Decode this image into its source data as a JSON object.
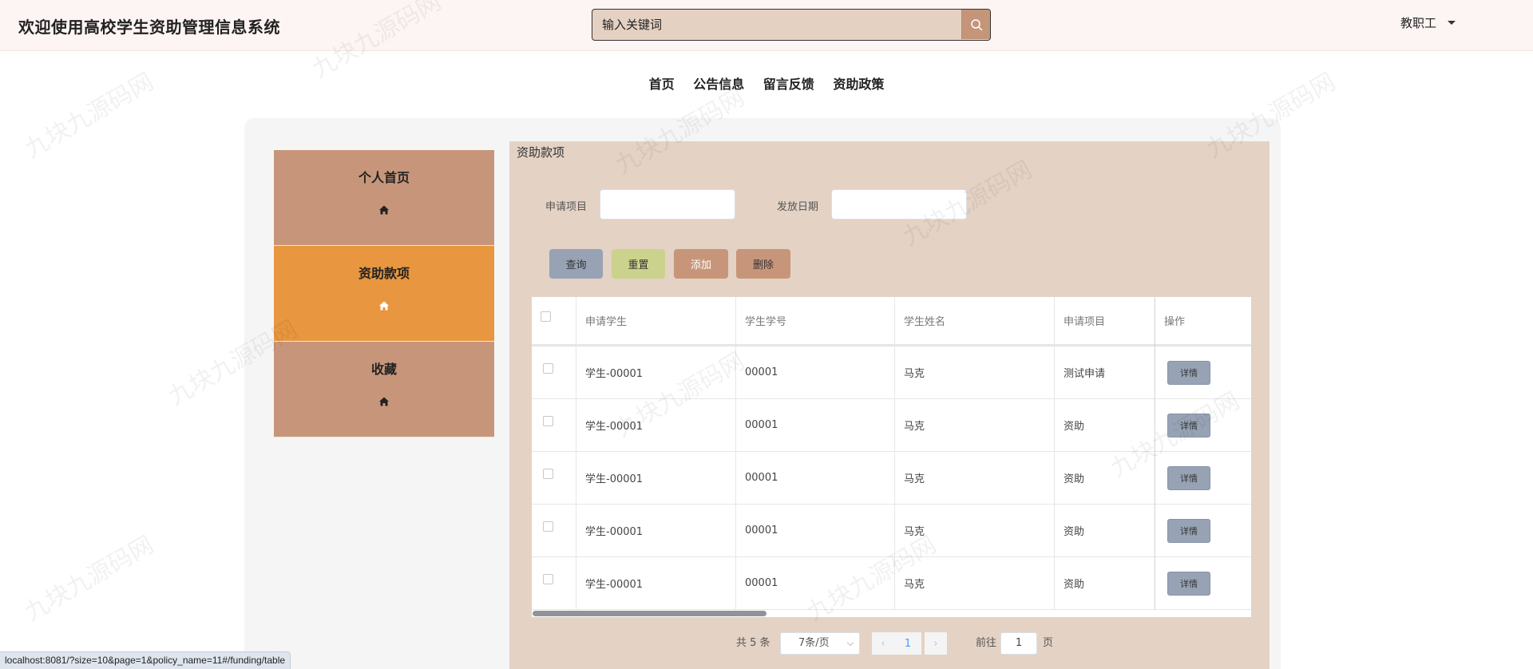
{
  "header": {
    "title": "欢迎使用高校学生资助管理信息系统",
    "search_placeholder": "输入关键词",
    "search_icon": "search-icon",
    "user_label": "教职工"
  },
  "nav": {
    "items": [
      {
        "label": "首页"
      },
      {
        "label": "公告信息"
      },
      {
        "label": "留言反馈"
      },
      {
        "label": "资助政策"
      }
    ]
  },
  "sidebar": {
    "items": [
      {
        "label": "个人首页",
        "icon": "home-icon",
        "active": false
      },
      {
        "label": "资助款项",
        "icon": "home-icon",
        "active": true
      },
      {
        "label": "收藏",
        "icon": "home-icon",
        "active": false
      }
    ]
  },
  "content": {
    "title": "资助款项",
    "filters": {
      "project_label": "申请项目",
      "date_label": "发放日期"
    },
    "buttons": {
      "query": "查询",
      "reset": "重置",
      "add": "添加",
      "delete": "删除"
    },
    "table": {
      "columns": [
        "申请学生",
        "学生学号",
        "学生姓名",
        "申请项目",
        "操作"
      ],
      "rows": [
        {
          "student": "学生-00001",
          "number": "00001",
          "name": "马克",
          "project": "测试申请",
          "action": "详情"
        },
        {
          "student": "学生-00001",
          "number": "00001",
          "name": "马克",
          "project": "资助",
          "action": "详情"
        },
        {
          "student": "学生-00001",
          "number": "00001",
          "name": "马克",
          "project": "资助",
          "action": "详情"
        },
        {
          "student": "学生-00001",
          "number": "00001",
          "name": "马克",
          "project": "资助",
          "action": "详情"
        },
        {
          "student": "学生-00001",
          "number": "00001",
          "name": "马克",
          "project": "资助",
          "action": "详情"
        }
      ]
    },
    "pagination": {
      "total": "共 5 条",
      "page_size": "7条/页",
      "current_page": "1",
      "goto_prefix": "前往",
      "goto_value": "1",
      "goto_suffix": "页"
    }
  },
  "statusbar": {
    "url": "localhost:8081/?size=10&page=1&policy_name=11#/funding/table"
  },
  "watermark": {
    "text": "九块九源码网"
  },
  "colors": {
    "header_bg": "#fdf5f3",
    "sidebar_item": "#c7967a",
    "sidebar_active": "#e8963f",
    "content_bg": "#e4d2c4",
    "query_btn": "#97a3b5",
    "reset_btn": "#cbd28d",
    "add_btn": "#c7967a"
  }
}
